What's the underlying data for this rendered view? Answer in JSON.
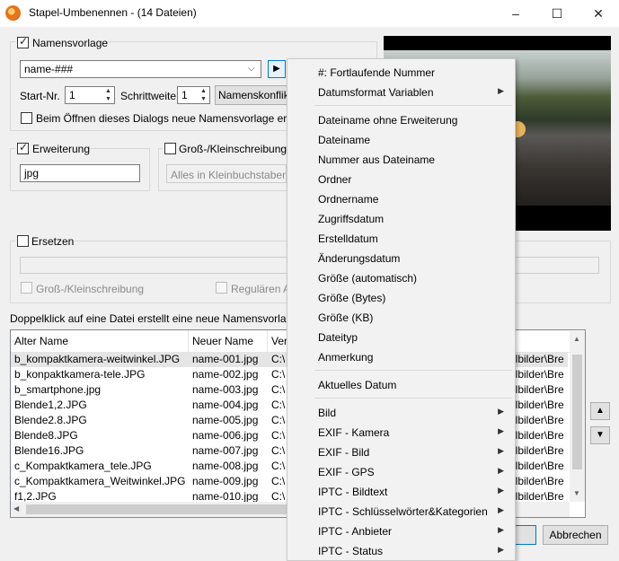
{
  "window": {
    "title": "Stapel-Umbenennen - (14 Dateien)",
    "minimize": "–",
    "maximize": "☐",
    "close": "✕"
  },
  "template": {
    "group_label": "Namensvorlage",
    "value": "name-###",
    "start_label": "Start-Nr.",
    "start_value": "1",
    "step_label": "Schrittweite",
    "step_value": "1",
    "conflict_button": "Namenskonflikt...",
    "new_on_open_label": "Beim Öffnen dieses Dialogs neue Namensvorlage erstellen"
  },
  "extension": {
    "label": "Erweiterung",
    "value": "jpg"
  },
  "case": {
    "label": "Groß-/Kleinschreibung",
    "value": "Alles in Kleinbuchstaben"
  },
  "replace": {
    "label": "Ersetzen",
    "case_label": "Groß-/Kleinschreibung",
    "regex_label": "Regulären Au"
  },
  "hint": "Doppelklick auf eine Datei erstellt eine neue Namensvorlage.",
  "table": {
    "headers": [
      "Alter Name",
      "Neuer Name",
      "Ver"
    ],
    "rows": [
      {
        "old": "b_kompaktkamera-weitwinkel.JPG",
        "new": "name-001.jpg",
        "dir": "C:\\",
        "tail": "elbilder\\Bre"
      },
      {
        "old": "b_konpaktkamera-tele.JPG",
        "new": "name-002.jpg",
        "dir": "C:\\",
        "tail": "elbilder\\Bre"
      },
      {
        "old": "b_smartphone.jpg",
        "new": "name-003.jpg",
        "dir": "C:\\",
        "tail": "elbilder\\Bre"
      },
      {
        "old": "Blende1,2.JPG",
        "new": "name-004.jpg",
        "dir": "C:\\",
        "tail": "elbilder\\Bre"
      },
      {
        "old": "Blende2.8.JPG",
        "new": "name-005.jpg",
        "dir": "C:\\",
        "tail": "elbilder\\Bre"
      },
      {
        "old": "Blende8.JPG",
        "new": "name-006.jpg",
        "dir": "C:\\",
        "tail": "elbilder\\Bre"
      },
      {
        "old": "Blende16.JPG",
        "new": "name-007.jpg",
        "dir": "C:\\",
        "tail": "elbilder\\Bre"
      },
      {
        "old": "c_Kompaktkamera_tele.JPG",
        "new": "name-008.jpg",
        "dir": "C:\\",
        "tail": "elbilder\\Bre"
      },
      {
        "old": "c_Kompaktkamera_Weitwinkel.JPG",
        "new": "name-009.jpg",
        "dir": "C:\\",
        "tail": "elbilder\\Bre"
      },
      {
        "old": "f1,2.JPG",
        "new": "name-010.jpg",
        "dir": "C:\\",
        "tail": "elbilder\\Bre"
      }
    ]
  },
  "buttons": {
    "cancel": "Abbrechen"
  },
  "menu": {
    "items": [
      {
        "label": "#: Fortlaufende Nummer",
        "submenu": false
      },
      {
        "label": "Datumsformat Variablen",
        "submenu": true
      },
      {
        "separator": true
      },
      {
        "label": "Dateiname ohne Erweiterung",
        "submenu": false
      },
      {
        "label": "Dateiname",
        "submenu": false
      },
      {
        "label": "Nummer aus Dateiname",
        "submenu": false
      },
      {
        "label": "Ordner",
        "submenu": false
      },
      {
        "label": "Ordnername",
        "submenu": false
      },
      {
        "label": "Zugriffsdatum",
        "submenu": false
      },
      {
        "label": "Erstelldatum",
        "submenu": false
      },
      {
        "label": "Änderungsdatum",
        "submenu": false
      },
      {
        "label": "Größe (automatisch)",
        "submenu": false
      },
      {
        "label": "Größe (Bytes)",
        "submenu": false
      },
      {
        "label": "Größe (KB)",
        "submenu": false
      },
      {
        "label": "Dateityp",
        "submenu": false
      },
      {
        "label": "Anmerkung",
        "submenu": false
      },
      {
        "separator": true
      },
      {
        "label": "Aktuelles Datum",
        "submenu": false
      },
      {
        "separator": true
      },
      {
        "label": "Bild",
        "submenu": true
      },
      {
        "label": "EXIF - Kamera",
        "submenu": true
      },
      {
        "label": "EXIF - Bild",
        "submenu": true
      },
      {
        "label": "EXIF - GPS",
        "submenu": true
      },
      {
        "label": "IPTC - Bildtext",
        "submenu": true
      },
      {
        "label": "IPTC - Schlüsselwörter&Kategorien",
        "submenu": true
      },
      {
        "label": "IPTC - Anbieter",
        "submenu": true
      },
      {
        "label": "IPTC - Status",
        "submenu": true
      }
    ]
  }
}
